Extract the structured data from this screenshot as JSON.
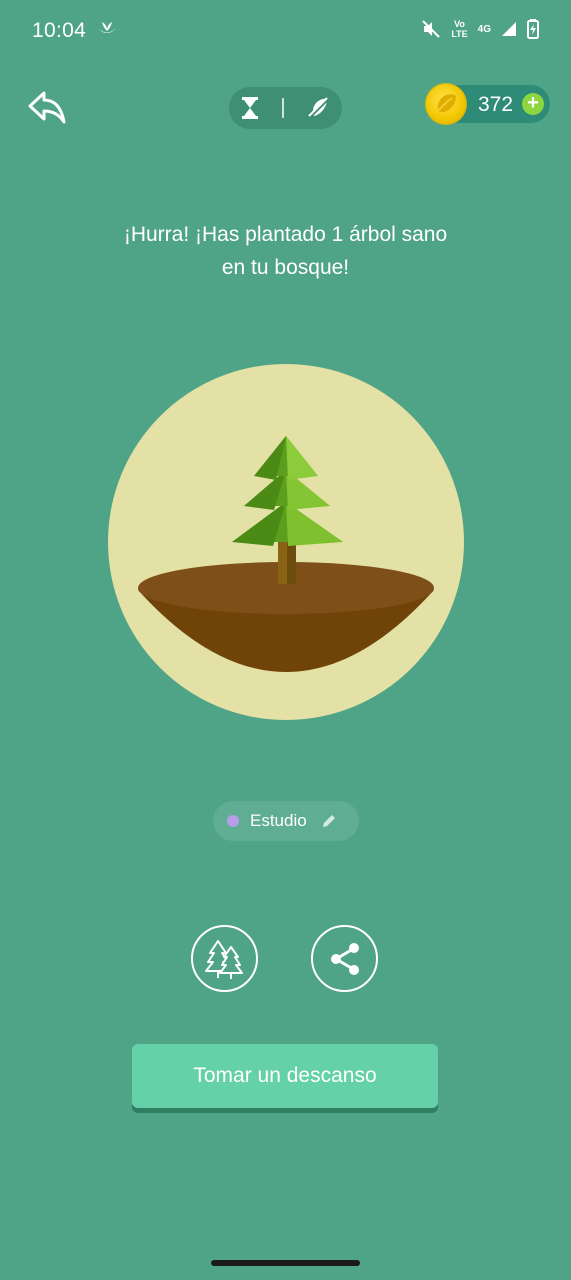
{
  "status_bar": {
    "time": "10:04",
    "volte_top": "Vo",
    "volte_bottom": "LTE",
    "network": "4G",
    "icons": [
      "plant-notification-icon",
      "mute-icon",
      "signal-icon",
      "battery-charging-icon"
    ]
  },
  "header": {
    "back_icon": "reply-arrow-icon",
    "mode_icons": [
      "hourglass-icon",
      "no-timer-icon"
    ],
    "coins": "372",
    "add_coins_icon": "plus-icon"
  },
  "headline": {
    "line1": "¡Hurra! ¡Has plantado 1 árbol sano",
    "line2": "en tu bosque!"
  },
  "tag": {
    "label": "Estudio",
    "dot_color": "#b89ce8",
    "edit_icon": "pencil-icon"
  },
  "actions": {
    "forest_icon": "forest-trees-icon",
    "share_icon": "share-icon"
  },
  "break_button": {
    "label": "Tomar un descanso"
  },
  "colors": {
    "background": "#4fa386",
    "button": "#65d1a9",
    "circle": "#e3e1a5",
    "soil": "#7a4a12"
  }
}
